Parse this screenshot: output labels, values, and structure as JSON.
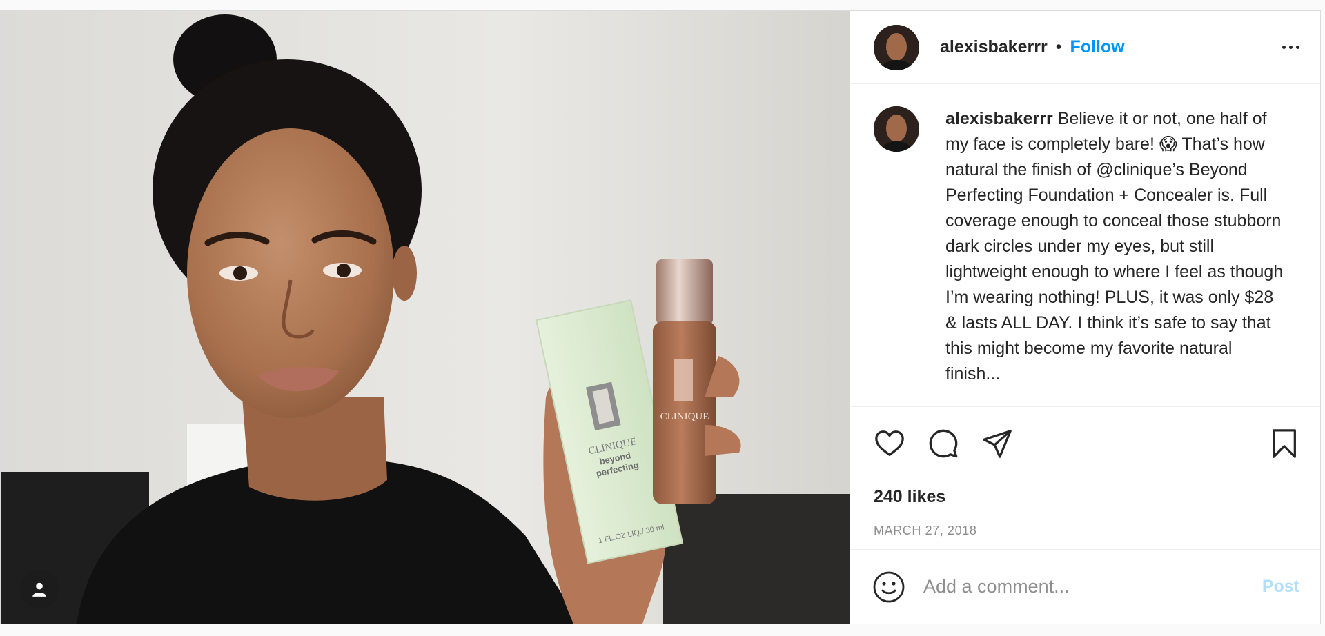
{
  "post": {
    "username": "alexisbakerrr",
    "separator": "•",
    "follow_label": "Follow",
    "more_icon": "more-options-icon",
    "caption": {
      "username": "alexisbakerrr",
      "text": "Believe it or not, one half of my face is completely bare! 😱 That’s how natural the finish of @clinique’s Beyond Perfecting Foundation + Concealer is. Full coverage enough to conceal those stubborn dark circles under my eyes, but still lightweight enough to where I feel as though I’m wearing nothing! PLUS, it was only $28 & lasts ALL DAY. I think it’s safe to say that this might become my favorite natural finish..."
    },
    "likes": "240 likes",
    "date": "MARCH 27, 2018",
    "comment": {
      "placeholder": "Add a comment...",
      "post_label": "Post"
    },
    "product": {
      "brand": "CLINIQUE",
      "line1": "beyond",
      "line2": "perfecting",
      "size": "1 FL.OZ.LIQ./ 30 ml"
    }
  },
  "icons": [
    "like-icon",
    "comment-icon",
    "share-icon",
    "save-icon",
    "emoji-icon",
    "user-tag-icon"
  ],
  "colors": {
    "link": "#0095f6",
    "post_disabled": "#b2dffc",
    "text": "#262626",
    "muted": "#8e8e8e",
    "border": "#dbdbdb"
  }
}
